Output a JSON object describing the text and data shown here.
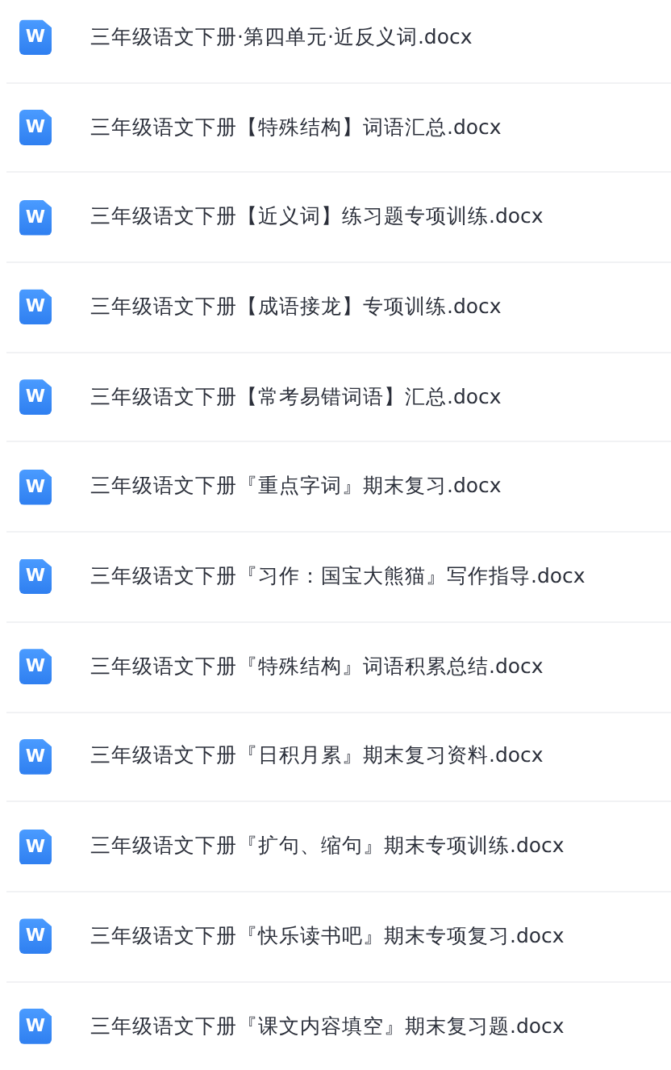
{
  "files": [
    {
      "name": "三年级语文下册·第四单元·近反义词.docx",
      "icon_letter": "W"
    },
    {
      "name": "三年级语文下册【特殊结构】词语汇总.docx",
      "icon_letter": "W"
    },
    {
      "name": "三年级语文下册【近义词】练习题专项训练.docx",
      "icon_letter": "W"
    },
    {
      "name": "三年级语文下册【成语接龙】专项训练.docx",
      "icon_letter": "W"
    },
    {
      "name": "三年级语文下册【常考易错词语】汇总.docx",
      "icon_letter": "W"
    },
    {
      "name": "三年级语文下册『重点字词』期末复习.docx",
      "icon_letter": "W"
    },
    {
      "name": "三年级语文下册『习作：国宝大熊猫』写作指导.docx",
      "icon_letter": "W"
    },
    {
      "name": "三年级语文下册『特殊结构』词语积累总结.docx",
      "icon_letter": "W"
    },
    {
      "name": "三年级语文下册『日积月累』期末复习资料.docx",
      "icon_letter": "W"
    },
    {
      "name": "三年级语文下册『扩句、缩句』期末专项训练.docx",
      "icon_letter": "W"
    },
    {
      "name": "三年级语文下册『快乐读书吧』期末专项复习.docx",
      "icon_letter": "W"
    },
    {
      "name": "三年级语文下册『课文内容填空』期末复习题.docx",
      "icon_letter": "W"
    }
  ]
}
